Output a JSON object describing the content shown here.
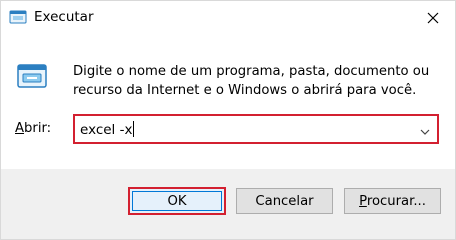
{
  "window": {
    "title": "Executar",
    "close_glyph": "✕"
  },
  "body": {
    "description_line1": "Digite o nome de um programa, pasta, documento ou",
    "description_line2": "recurso da Internet e o Windows o abrirá para você.",
    "open_label_accel": "A",
    "open_label_rest": "brir:"
  },
  "command": {
    "value": "excel -x"
  },
  "buttons": {
    "ok": "OK",
    "cancel": "Cancelar",
    "browse_accel": "P",
    "browse_rest": "rocurar..."
  },
  "icons": {
    "title": "run-app-icon",
    "dialog": "run-dialog-icon",
    "close": "close-icon",
    "dropdown": "chevron-down-icon"
  },
  "colors": {
    "highlight": "#d32030",
    "accent": "#0078d7",
    "footer": "#f0f0f0"
  }
}
